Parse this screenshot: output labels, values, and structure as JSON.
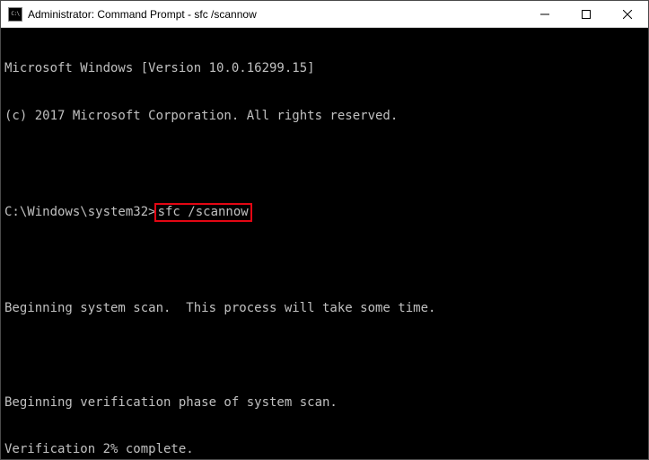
{
  "titlebar": {
    "icon_label": "C:\\",
    "text": "Administrator: Command Prompt - sfc  /scannow",
    "minimize": "Minimize",
    "maximize": "Maximize",
    "close": "Close"
  },
  "terminal": {
    "line1": "Microsoft Windows [Version 10.0.16299.15]",
    "line2": "(c) 2017 Microsoft Corporation. All rights reserved.",
    "prompt_prefix": "C:\\Windows\\system32>",
    "command": "sfc /scannow",
    "line_blank": "",
    "line_scan": "Beginning system scan.  This process will take some time.",
    "line_verify": "Beginning verification phase of system scan.",
    "line_progress": "Verification 2% complete."
  }
}
